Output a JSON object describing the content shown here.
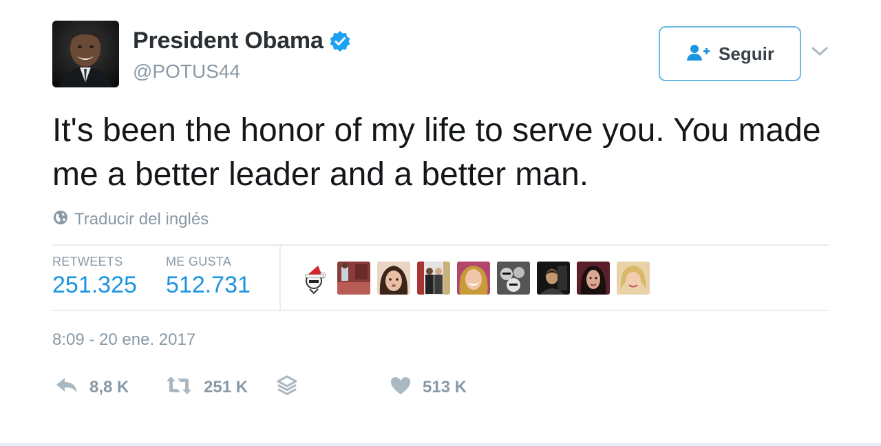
{
  "user": {
    "display_name": "President Obama",
    "handle": "@POTUS44",
    "verified": true,
    "avatar_icon": "profile-photo"
  },
  "follow": {
    "label": "Seguir",
    "icon": "add-user-icon"
  },
  "tweet": {
    "text": "It's been the honor of my life to serve you. You made me a better leader and a better man.",
    "translate_label": "Traducir del inglés"
  },
  "stats": {
    "retweets_label": "RETWEETS",
    "retweets_value": "251.325",
    "likes_label": "ME GUSTA",
    "likes_value": "512.731"
  },
  "timestamp": "8:09 - 20 ene. 2017",
  "actions": {
    "reply_count": "8,8 K",
    "retweet_count": "251 K",
    "like_count": "513 K"
  },
  "colors": {
    "accent": "#1b95e0",
    "follow_border": "#6ab9e6",
    "muted": "#8899a6",
    "divider": "#e6ecf0"
  }
}
